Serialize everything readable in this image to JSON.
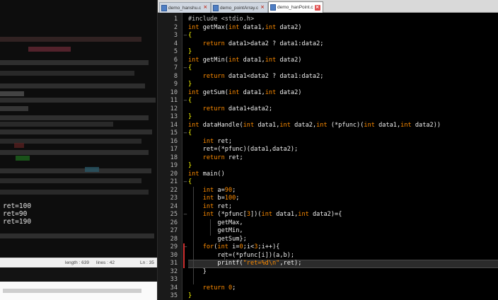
{
  "console": {
    "lines": [
      "ret=100",
      "ret=90",
      "ret=190"
    ],
    "status": {
      "length": "length : 639",
      "lines": "lines : 42",
      "ln": "Ln : 35"
    }
  },
  "editor": {
    "tabs": [
      {
        "label": "demo_hanshu.c",
        "active": false
      },
      {
        "label": "demo_pointArray.c",
        "active": false
      },
      {
        "label": "demo_hanPoint.c",
        "active": true
      }
    ],
    "current_line": 31,
    "lines": [
      {
        "n": "1",
        "fold": "",
        "tokens": [
          [
            "pp",
            "#include <stdio.h>"
          ]
        ]
      },
      {
        "n": "2",
        "fold": "",
        "tokens": [
          [
            "kw",
            "int"
          ],
          [
            "",
            " getMax("
          ],
          [
            "kw",
            "int"
          ],
          [
            "",
            " data1,"
          ],
          [
            "kw",
            "int"
          ],
          [
            "",
            " data2)"
          ]
        ]
      },
      {
        "n": "3",
        "fold": "−",
        "tokens": [
          [
            "brace",
            "{"
          ]
        ]
      },
      {
        "n": "4",
        "fold": "",
        "tokens": [
          [
            "",
            "    "
          ],
          [
            "kw",
            "return"
          ],
          [
            "",
            " data1>data2 ? data1:data2;"
          ]
        ]
      },
      {
        "n": "5",
        "fold": "",
        "tokens": [
          [
            "brace",
            "}"
          ]
        ]
      },
      {
        "n": "6",
        "fold": "",
        "tokens": [
          [
            "kw",
            "int"
          ],
          [
            "",
            " getMin("
          ],
          [
            "kw",
            "int"
          ],
          [
            "",
            " data1,"
          ],
          [
            "kw",
            "int"
          ],
          [
            "",
            " data2)"
          ]
        ]
      },
      {
        "n": "7",
        "fold": "−",
        "tokens": [
          [
            "brace",
            "{"
          ]
        ]
      },
      {
        "n": "8",
        "fold": "",
        "tokens": [
          [
            "",
            "    "
          ],
          [
            "kw",
            "return"
          ],
          [
            "",
            " data1<data2 ? data1:data2;"
          ]
        ]
      },
      {
        "n": "9",
        "fold": "",
        "tokens": [
          [
            "brace",
            "}"
          ]
        ]
      },
      {
        "n": "10",
        "fold": "",
        "tokens": [
          [
            "kw",
            "int"
          ],
          [
            "",
            " getSum("
          ],
          [
            "kw",
            "int"
          ],
          [
            "",
            " data1,"
          ],
          [
            "kw",
            "int"
          ],
          [
            "",
            " data2)"
          ]
        ]
      },
      {
        "n": "11",
        "fold": "−",
        "tokens": [
          [
            "brace",
            "{"
          ]
        ]
      },
      {
        "n": "12",
        "fold": "",
        "tokens": [
          [
            "",
            "    "
          ],
          [
            "kw",
            "return"
          ],
          [
            "",
            " data1+data2;"
          ]
        ]
      },
      {
        "n": "13",
        "fold": "",
        "tokens": [
          [
            "brace",
            "}"
          ]
        ]
      },
      {
        "n": "14",
        "fold": "",
        "tokens": [
          [
            "kw",
            "int"
          ],
          [
            "",
            " dataHandle("
          ],
          [
            "kw",
            "int"
          ],
          [
            "",
            " data1,"
          ],
          [
            "kw",
            "int"
          ],
          [
            "",
            " data2,"
          ],
          [
            "kw",
            "int"
          ],
          [
            "",
            " (*pfunc)("
          ],
          [
            "kw",
            "int"
          ],
          [
            "",
            " data1,"
          ],
          [
            "kw",
            "int"
          ],
          [
            "",
            " data2))"
          ]
        ]
      },
      {
        "n": "15",
        "fold": "−",
        "tokens": [
          [
            "brace",
            "{"
          ]
        ]
      },
      {
        "n": "16",
        "fold": "",
        "tokens": [
          [
            "",
            "    "
          ],
          [
            "kw",
            "int"
          ],
          [
            "",
            " ret;"
          ]
        ]
      },
      {
        "n": "17",
        "fold": "",
        "tokens": [
          [
            "",
            "    ret=(*pfunc)(data1,data2);"
          ]
        ]
      },
      {
        "n": "18",
        "fold": "",
        "tokens": [
          [
            "",
            "    "
          ],
          [
            "kw",
            "return"
          ],
          [
            "",
            " ret;"
          ]
        ]
      },
      {
        "n": "19",
        "fold": "",
        "tokens": [
          [
            "brace",
            "}"
          ]
        ]
      },
      {
        "n": "20",
        "fold": "",
        "tokens": [
          [
            "kw",
            "int"
          ],
          [
            "",
            " main()"
          ]
        ]
      },
      {
        "n": "21",
        "fold": "−",
        "tokens": [
          [
            "brace",
            "{"
          ]
        ]
      },
      {
        "n": "22",
        "fold": "",
        "tokens": [
          [
            "",
            "    "
          ],
          [
            "kw",
            "int"
          ],
          [
            "",
            " a="
          ],
          [
            "num",
            "90"
          ],
          [
            "",
            ";"
          ]
        ]
      },
      {
        "n": "23",
        "fold": "",
        "tokens": [
          [
            "",
            "    "
          ],
          [
            "kw",
            "int"
          ],
          [
            "",
            " b="
          ],
          [
            "num",
            "100"
          ],
          [
            "",
            ";"
          ]
        ]
      },
      {
        "n": "24",
        "fold": "",
        "tokens": [
          [
            "",
            "    "
          ],
          [
            "kw",
            "int"
          ],
          [
            "",
            " ret;"
          ]
        ]
      },
      {
        "n": "25",
        "fold": "−",
        "tokens": [
          [
            "",
            "    "
          ],
          [
            "kw",
            "int"
          ],
          [
            "",
            " (*pfunc["
          ],
          [
            "num",
            "3"
          ],
          [
            "",
            "])("
          ],
          [
            "kw",
            "int"
          ],
          [
            "",
            " data1,"
          ],
          [
            "kw",
            "int"
          ],
          [
            "",
            " data2)={"
          ]
        ]
      },
      {
        "n": "26",
        "fold": "",
        "tokens": [
          [
            "",
            "        getMax,"
          ]
        ]
      },
      {
        "n": "27",
        "fold": "",
        "tokens": [
          [
            "",
            "        getMin,"
          ]
        ]
      },
      {
        "n": "28",
        "fold": "",
        "tokens": [
          [
            "",
            "        getSum};"
          ]
        ]
      },
      {
        "n": "29",
        "fold": "−",
        "tokens": [
          [
            "",
            "    "
          ],
          [
            "kw",
            "for"
          ],
          [
            "",
            "("
          ],
          [
            "kw",
            "int"
          ],
          [
            "",
            " i="
          ],
          [
            "num",
            "0"
          ],
          [
            "",
            ";i<"
          ],
          [
            "num",
            "3"
          ],
          [
            "",
            ";i++){"
          ]
        ]
      },
      {
        "n": "30",
        "fold": "",
        "tokens": [
          [
            "",
            "        ret=(*pfunc[i])(a,b);"
          ]
        ]
      },
      {
        "n": "31",
        "fold": "",
        "tokens": [
          [
            "",
            "        printf("
          ],
          [
            "str",
            "\"ret=%d\\n\""
          ],
          [
            "",
            ",ret);"
          ]
        ]
      },
      {
        "n": "32",
        "fold": "",
        "tokens": [
          [
            "",
            "    }"
          ]
        ]
      },
      {
        "n": "33",
        "fold": "",
        "tokens": []
      },
      {
        "n": "34",
        "fold": "",
        "tokens": [
          [
            "",
            "    "
          ],
          [
            "kw",
            "return"
          ],
          [
            "",
            " "
          ],
          [
            "num",
            "0"
          ],
          [
            "",
            ";"
          ]
        ]
      },
      {
        "n": "35",
        "fold": "",
        "tokens": [
          [
            "brace",
            "}"
          ]
        ]
      }
    ]
  }
}
